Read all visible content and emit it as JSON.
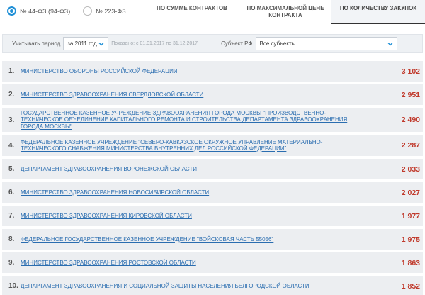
{
  "law_options": [
    {
      "label": "№ 44-ФЗ (94-ФЗ)",
      "selected": true
    },
    {
      "label": "№ 223-ФЗ",
      "selected": false
    }
  ],
  "tabs": [
    {
      "label": "ПО СУММЕ КОНТРАКТОВ",
      "active": false
    },
    {
      "label": "ПО МАКСИМАЛЬНОЙ ЦЕНЕ КОНТРАКТА",
      "active": false
    },
    {
      "label": "ПО КОЛИЧЕСТВУ ЗАКУПОК",
      "active": true
    }
  ],
  "filters": {
    "period_label": "Учитывать период",
    "period_value": "за 2011 год",
    "shown_note": "Показано: с 01.01.2017 по 31.12.2017",
    "subject_label": "Субъект РФ",
    "subject_value": "Все субъекты"
  },
  "rows": [
    {
      "rank": "1.",
      "name": "МИНИСТЕРСТВО ОБОРОНЫ РОССИЙСКОЙ ФЕДЕРАЦИИ",
      "value": "3 102"
    },
    {
      "rank": "2.",
      "name": "МИНИСТЕРСТВО ЗДРАВООХРАНЕНИЯ СВЕРДЛОВСКОЙ ОБЛАСТИ",
      "value": "2 951"
    },
    {
      "rank": "3.",
      "name": "ГОСУДАРСТВЕННОЕ КАЗЕННОЕ УЧРЕЖДЕНИЕ ЗДРАВООХРАНЕНИЯ ГОРОДА МОСКВЫ \"ПРОИЗВОДСТВЕННО-ТЕХНИЧЕСКОЕ ОБЪЕДИНЕНИЕ КАПИТАЛЬНОГО РЕМОНТА И СТРОИТЕЛЬСТВА ДЕПАРТАМЕНТА ЗДРАВООХРАНЕНИЯ ГОРОДА МОСКВЫ\"",
      "value": "2 490"
    },
    {
      "rank": "4.",
      "name": "ФЕДЕРАЛЬНОЕ КАЗЕННОЕ УЧРЕЖДЕНИЕ \"СЕВЕРО-КАВКАЗСКОЕ ОКРУЖНОЕ УПРАВЛЕНИЕ МАТЕРИАЛЬНО-ТЕХНИЧЕСКОГО СНАБЖЕНИЯ МИНИСТЕРСТВА ВНУТРЕННИХ ДЕЛ РОССИЙСКОЙ ФЕДЕРАЦИИ\"",
      "value": "2 287"
    },
    {
      "rank": "5.",
      "name": "ДЕПАРТАМЕНТ ЗДРАВООХРАНЕНИЯ ВОРОНЕЖСКОЙ ОБЛАСТИ",
      "value": "2 033"
    },
    {
      "rank": "6.",
      "name": "МИНИСТЕРСТВО ЗДРАВООХРАНЕНИЯ НОВОСИБИРСКОЙ ОБЛАСТИ",
      "value": "2 027"
    },
    {
      "rank": "7.",
      "name": "МИНИСТЕРСТВО ЗДРАВООХРАНЕНИЯ КИРОВСКОЙ ОБЛАСТИ",
      "value": "1 977"
    },
    {
      "rank": "8.",
      "name": "ФЕДЕРАЛЬНОЕ ГОСУДАРСТВЕННОЕ КАЗЕННОЕ УЧРЕЖДЕНИЕ \"ВОЙСКОВАЯ ЧАСТЬ 55056\"",
      "value": "1 975"
    },
    {
      "rank": "9.",
      "name": "МИНИСТЕРСТВО ЗДРАВООХРАНЕНИЯ РОСТОВСКОЙ ОБЛАСТИ",
      "value": "1 863"
    },
    {
      "rank": "10.",
      "name": "ДЕПАРТАМЕНТ ЗДРАВООХРАНЕНИЯ И СОЦИАЛЬНОЙ ЗАЩИТЫ НАСЕЛЕНИЯ БЕЛГОРОДСКОЙ ОБЛАСТИ",
      "value": "1 852"
    }
  ],
  "colors": {
    "accent": "#1f8fd6",
    "link": "#2a6db0",
    "value": "#c0392b",
    "row_bg": "#eceef1"
  }
}
